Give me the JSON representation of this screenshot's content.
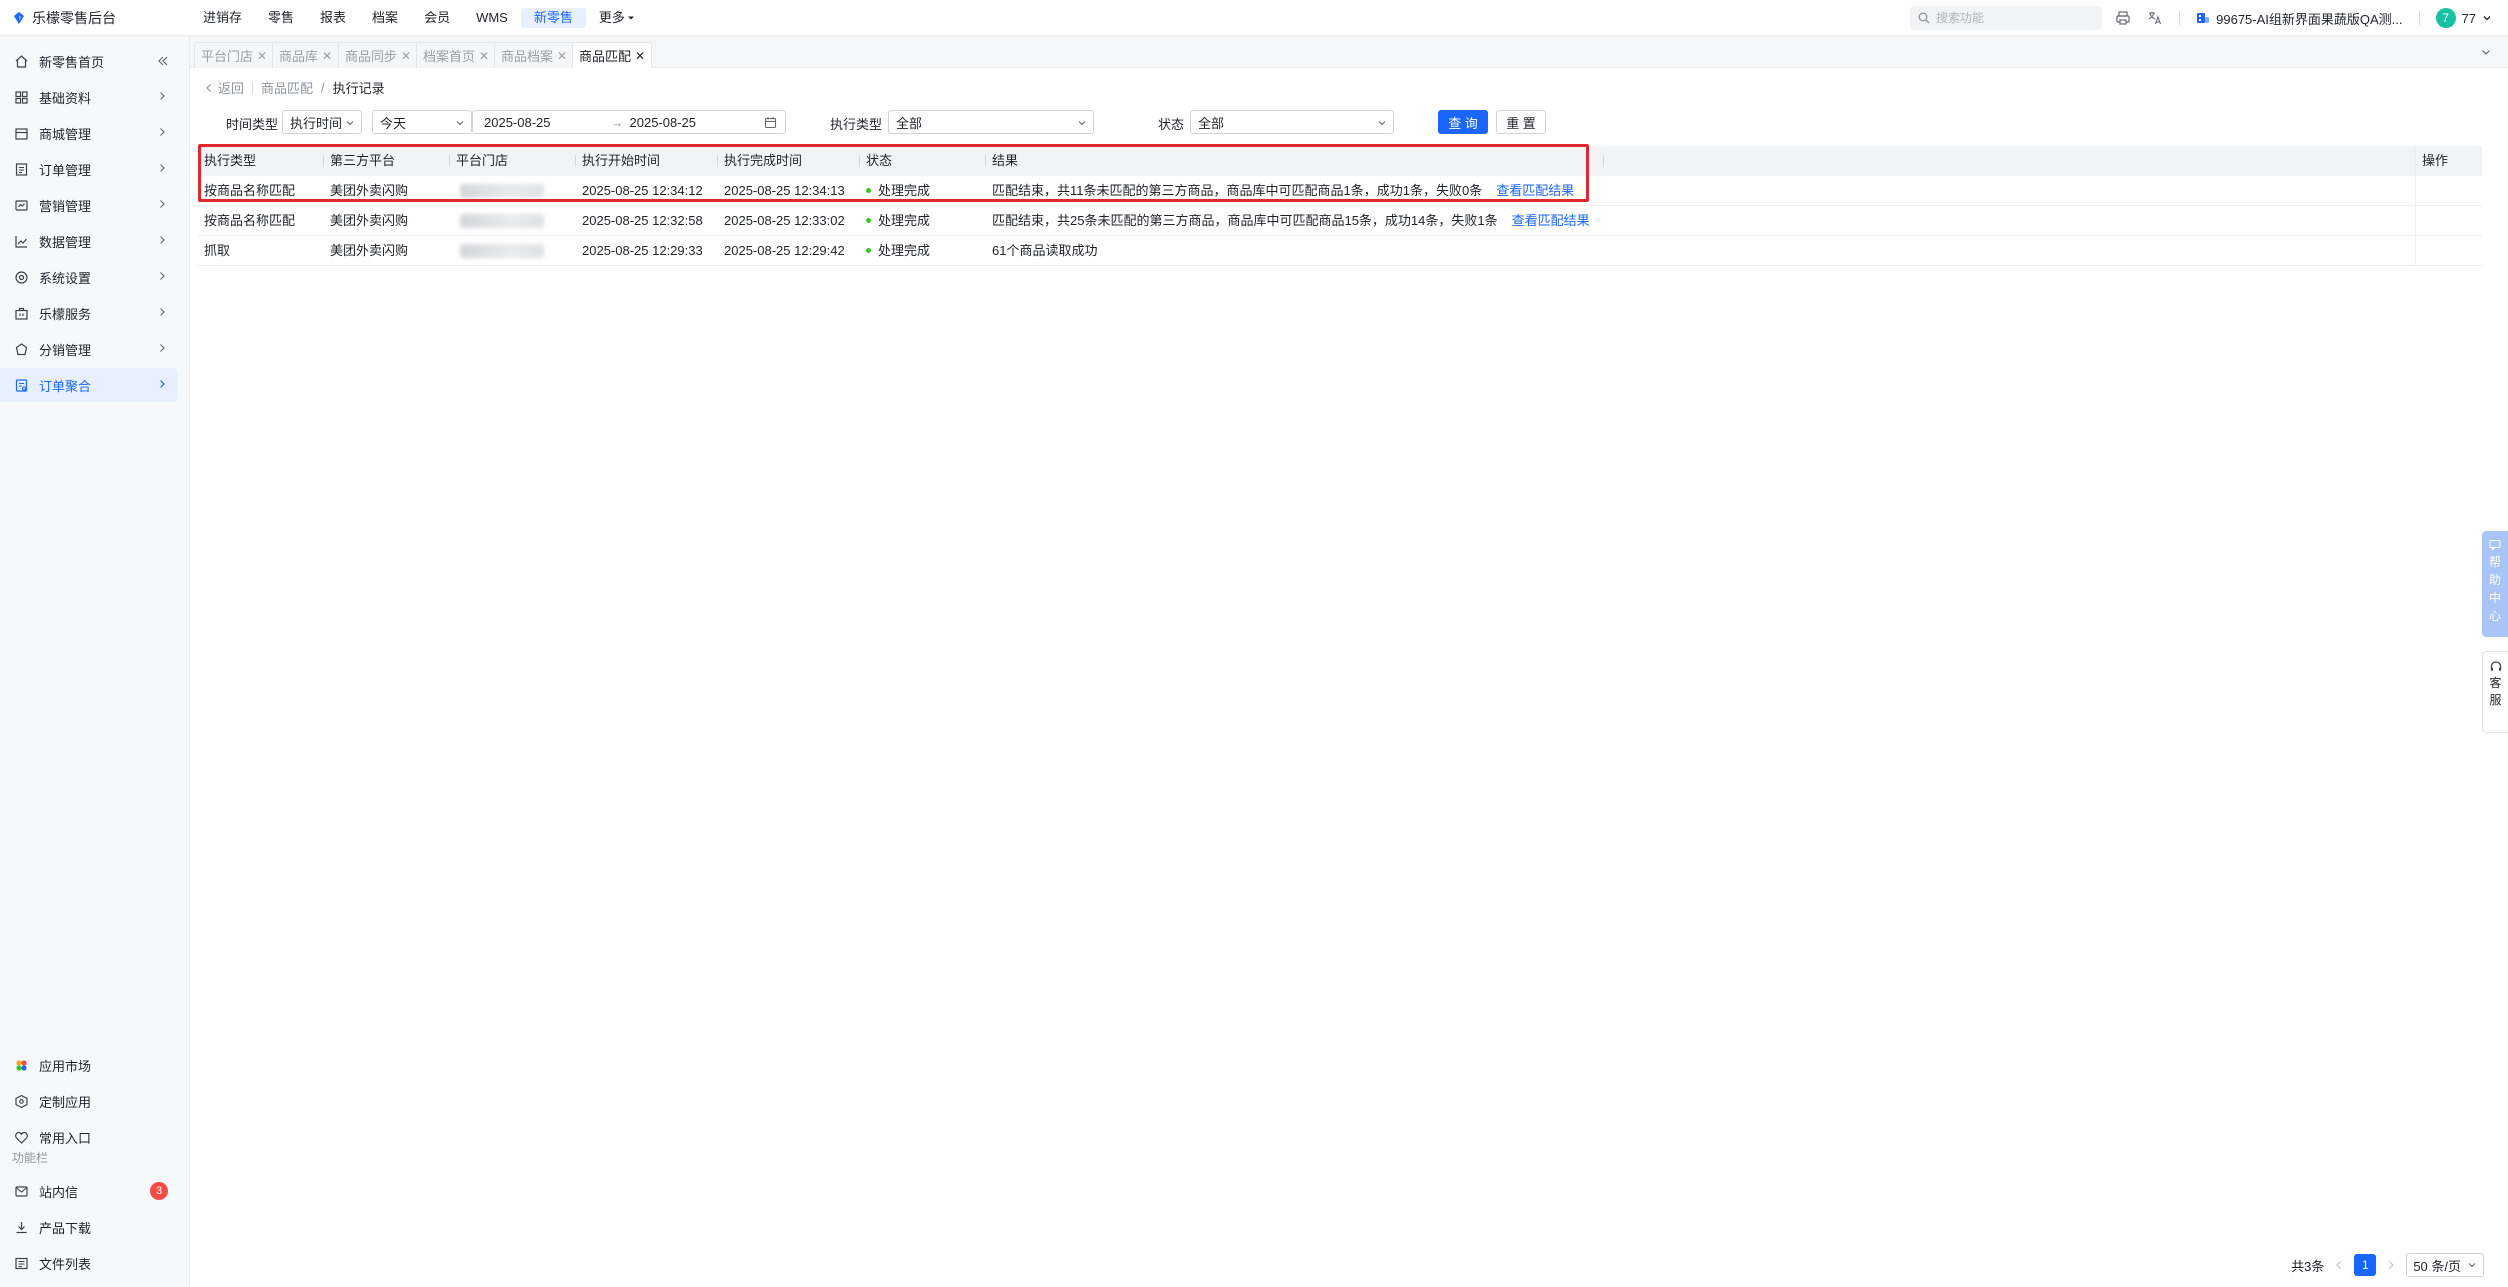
{
  "app": {
    "title": "乐檬零售后台"
  },
  "topnav": {
    "items": [
      "进销存",
      "零售",
      "报表",
      "档案",
      "会员",
      "WMS",
      "新零售",
      "更多"
    ],
    "active_index": 6
  },
  "search": {
    "placeholder": "搜索功能"
  },
  "org": {
    "name": "99675-AI组新界面果蔬版QA测..."
  },
  "user": {
    "avatar_text": "7",
    "id": "77"
  },
  "sidebar": {
    "items": [
      {
        "label": "新零售首页",
        "icon": "home-icon"
      },
      {
        "label": "基础资料",
        "icon": "grid-icon"
      },
      {
        "label": "商城管理",
        "icon": "store-icon"
      },
      {
        "label": "订单管理",
        "icon": "order-icon"
      },
      {
        "label": "营销管理",
        "icon": "marketing-icon"
      },
      {
        "label": "数据管理",
        "icon": "chart-icon"
      },
      {
        "label": "系统设置",
        "icon": "settings-icon"
      },
      {
        "label": "乐檬服务",
        "icon": "service-icon"
      },
      {
        "label": "分销管理",
        "icon": "distribution-icon"
      },
      {
        "label": "订单聚合",
        "icon": "aggregate-icon"
      }
    ],
    "active_index": 9,
    "bottom_items": [
      {
        "label": "应用市场",
        "icon": "app-market-icon"
      },
      {
        "label": "定制应用",
        "icon": "custom-app-icon"
      },
      {
        "label": "常用入口",
        "icon": "heart-icon"
      }
    ],
    "func_label": "功能栏",
    "func_items": [
      {
        "label": "站内信",
        "icon": "mail-icon",
        "badge": "3"
      },
      {
        "label": "产品下载",
        "icon": "download-icon"
      },
      {
        "label": "文件列表",
        "icon": "file-list-icon"
      }
    ]
  },
  "tabs": [
    {
      "label": "平台门店"
    },
    {
      "label": "商品库"
    },
    {
      "label": "商品同步"
    },
    {
      "label": "档案首页"
    },
    {
      "label": "商品档案"
    },
    {
      "label": "商品匹配"
    }
  ],
  "breadcrumb": {
    "back": "返回",
    "parent": "商品匹配",
    "separator": "/",
    "current": "执行记录"
  },
  "filters": {
    "time_type_label": "时间类型",
    "time_type_value": "执行时间",
    "range_value": "今天",
    "date_start": "2025-08-25",
    "date_end": "2025-08-25",
    "date_arrow": "→",
    "exec_type_label": "执行类型",
    "exec_type_value": "全部",
    "status_label": "状态",
    "status_value": "全部",
    "query_button": "查 询",
    "reset_button": "重 置"
  },
  "table": {
    "columns": [
      "执行类型",
      "第三方平台",
      "平台门店",
      "执行开始时间",
      "执行完成时间",
      "状态",
      "结果",
      "操作"
    ],
    "rows": [
      {
        "type": "按商品名称匹配",
        "platform": "美团外卖闪购",
        "start": "2025-08-25 12:34:12",
        "end": "2025-08-25 12:34:13",
        "status": "处理完成",
        "result": "匹配结束，共11条未匹配的第三方商品，商品库中可匹配商品1条，成功1条，失败0条",
        "link": "查看匹配结果"
      },
      {
        "type": "按商品名称匹配",
        "platform": "美团外卖闪购",
        "start": "2025-08-25 12:32:58",
        "end": "2025-08-25 12:33:02",
        "status": "处理完成",
        "result": "匹配结束，共25条未匹配的第三方商品，商品库中可匹配商品15条，成功14条，失败1条",
        "link": "查看匹配结果"
      },
      {
        "type": "抓取",
        "platform": "美团外卖闪购",
        "start": "2025-08-25 12:29:33",
        "end": "2025-08-25 12:29:42",
        "status": "处理完成",
        "result": "61个商品读取成功",
        "link": ""
      }
    ]
  },
  "pagination": {
    "total": "共3条",
    "current_page": "1",
    "page_size": "50 条/页"
  },
  "help_widget": {
    "chars": [
      "帮",
      "助",
      "中",
      "心"
    ]
  },
  "cs_widget": {
    "chars": [
      "客",
      "服"
    ]
  },
  "colors": {
    "accent": "#1a66ff",
    "success": "#34c724",
    "highlight_box": "#e0282e",
    "badge": "#f54a45"
  }
}
